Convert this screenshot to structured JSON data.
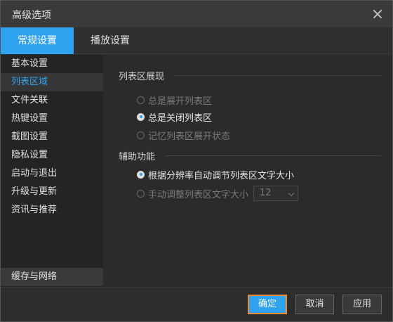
{
  "window": {
    "title": "高级选项"
  },
  "tabs": [
    {
      "label": "常规设置",
      "active": true
    },
    {
      "label": "播放设置",
      "active": false
    }
  ],
  "sidebar": {
    "items": [
      {
        "label": "基本设置"
      },
      {
        "label": "列表区域",
        "active": true
      },
      {
        "label": "文件关联"
      },
      {
        "label": "热键设置"
      },
      {
        "label": "截图设置"
      },
      {
        "label": "隐私设置"
      },
      {
        "label": "启动与退出"
      },
      {
        "label": "升级与更新"
      },
      {
        "label": "资讯与推荐"
      }
    ],
    "bottom_item": {
      "label": "缓存与网络"
    }
  },
  "list_display": {
    "title": "列表区展现",
    "options": [
      {
        "label": "总是展开列表区",
        "checked": false,
        "enabled": false
      },
      {
        "label": "总是关闭列表区",
        "checked": true,
        "enabled": true
      },
      {
        "label": "记忆列表区展开状态",
        "checked": false,
        "enabled": false
      }
    ]
  },
  "assist": {
    "title": "辅助功能",
    "options": [
      {
        "label": "根据分辨率自动调节列表区文字大小",
        "checked": true,
        "enabled": true
      },
      {
        "label": "手动调整列表区文字大小",
        "checked": false,
        "enabled": false
      }
    ],
    "font_size_select": {
      "value": "12"
    }
  },
  "footer": {
    "ok_label": "确定",
    "cancel_label": "取消",
    "apply_label": "应用"
  },
  "colors": {
    "accent": "#2fa2f0",
    "focus_border": "#f08b35"
  }
}
